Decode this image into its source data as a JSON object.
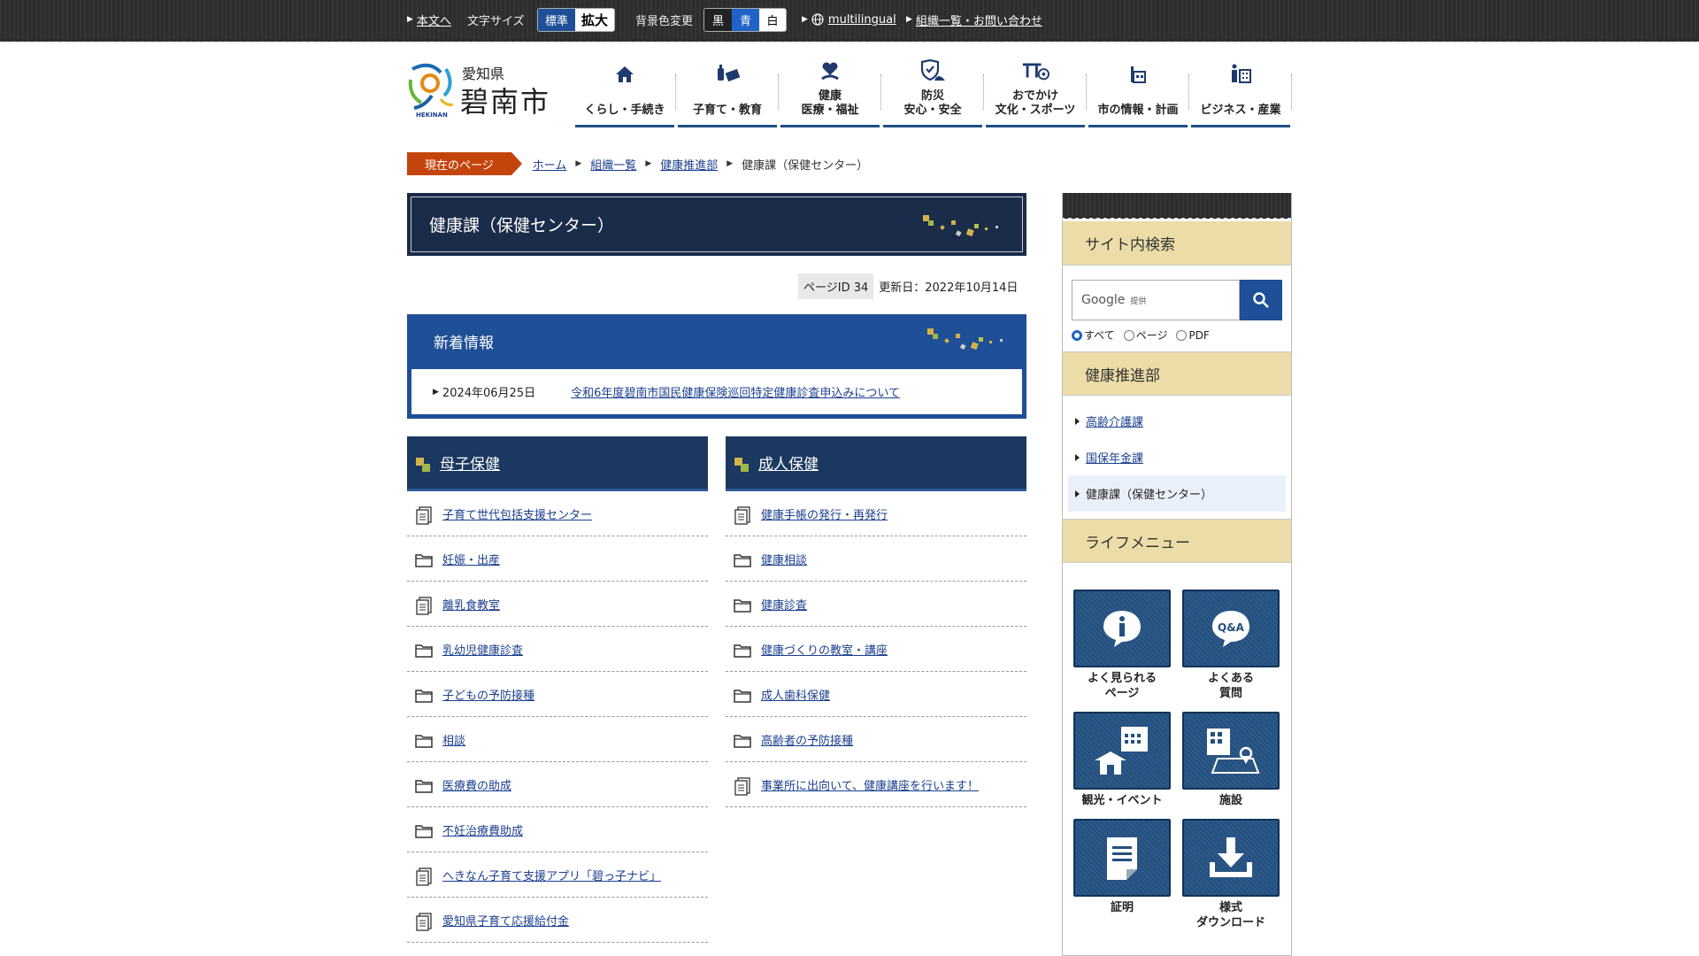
{
  "topbar": {
    "skip_label": "本文へ",
    "font_size_label": "文字サイズ",
    "font_standard": "標準",
    "font_large": "拡大",
    "bg_label": "背景色変更",
    "bg_black": "黒",
    "bg_blue": "青",
    "bg_white": "白",
    "multilingual": "multilingual",
    "contact": "組織一覧・お問い合わせ"
  },
  "logo": {
    "pref": "愛知県",
    "city": "碧南市",
    "roman": "HEKINAN"
  },
  "nav": [
    {
      "label": "くらし・手続き",
      "icon": "house-icon"
    },
    {
      "label": "子育て・教育",
      "icon": "bottle-book-icon"
    },
    {
      "label": "健康\n医療・福祉",
      "icon": "heart-hand-icon"
    },
    {
      "label": "防災\n安心・安全",
      "icon": "shield-icon"
    },
    {
      "label": "おでかけ\n文化・スポーツ",
      "icon": "torii-ball-icon"
    },
    {
      "label": "市の情報・計画",
      "icon": "building-icon"
    },
    {
      "label": "ビジネス・産業",
      "icon": "office-icon"
    }
  ],
  "breadcrumb": {
    "current_label": "現在のページ",
    "items": [
      "ホーム",
      "組織一覧",
      "健康推進部"
    ],
    "current": "健康課（保健センター）"
  },
  "page": {
    "title": "健康課（保健センター）",
    "page_id": "ページID 34",
    "updated": "更新日：2022年10月14日"
  },
  "news": {
    "heading": "新着情報",
    "items": [
      {
        "date": "2024年06月25日",
        "title": "令和6年度碧南市国民健康保険巡回特定健康診査申込みについて"
      }
    ]
  },
  "left_column": {
    "heading": "母子保健",
    "items": [
      {
        "label": "子育て世代包括支援センター",
        "type": "page"
      },
      {
        "label": "妊娠・出産",
        "type": "folder"
      },
      {
        "label": "離乳食教室",
        "type": "page"
      },
      {
        "label": "乳幼児健康診査",
        "type": "folder"
      },
      {
        "label": "子どもの予防接種",
        "type": "folder"
      },
      {
        "label": "相談",
        "type": "folder"
      },
      {
        "label": "医療費の助成",
        "type": "folder"
      },
      {
        "label": "不妊治療費助成",
        "type": "folder"
      },
      {
        "label": "へきなん子育て支援アプリ「碧っ子ナビ」",
        "type": "page"
      },
      {
        "label": "愛知県子育て応援給付金",
        "type": "page"
      }
    ]
  },
  "right_column": {
    "heading": "成人保健",
    "items": [
      {
        "label": "健康手帳の発行・再発行",
        "type": "page"
      },
      {
        "label": "健康相談",
        "type": "folder"
      },
      {
        "label": "健康診査",
        "type": "folder"
      },
      {
        "label": "健康づくりの教室・講座",
        "type": "folder"
      },
      {
        "label": "成人歯科保健",
        "type": "folder"
      },
      {
        "label": "高齢者の予防接種",
        "type": "folder"
      },
      {
        "label": "事業所に出向いて、健康講座を行います！",
        "type": "page"
      }
    ]
  },
  "sidebar": {
    "search_heading": "サイト内検索",
    "search_brand": "Google",
    "search_provided": "提供",
    "radios": [
      "すべて",
      "ページ",
      "PDF"
    ],
    "dept_heading": "健康推進部",
    "dept_items": [
      "高齢介護課",
      "国保年金課",
      "健康課（保健センター）"
    ],
    "life_heading": "ライフメニュー",
    "tiles": [
      {
        "label": "よく見られる\nページ",
        "icon": "info-icon"
      },
      {
        "label": "よくある\n質問",
        "icon": "qa-icon"
      },
      {
        "label": "観光・イベント",
        "icon": "calendar-house-icon"
      },
      {
        "label": "施設",
        "icon": "facility-map-icon"
      },
      {
        "label": "証明",
        "icon": "document-icon"
      },
      {
        "label": "様式\nダウンロード",
        "icon": "download-icon"
      }
    ]
  },
  "colors": {
    "navy": "#1a2c4a",
    "blue": "#1f4f96",
    "accent_orange": "#c4450c",
    "sidebar_header": "#ecdca7"
  }
}
